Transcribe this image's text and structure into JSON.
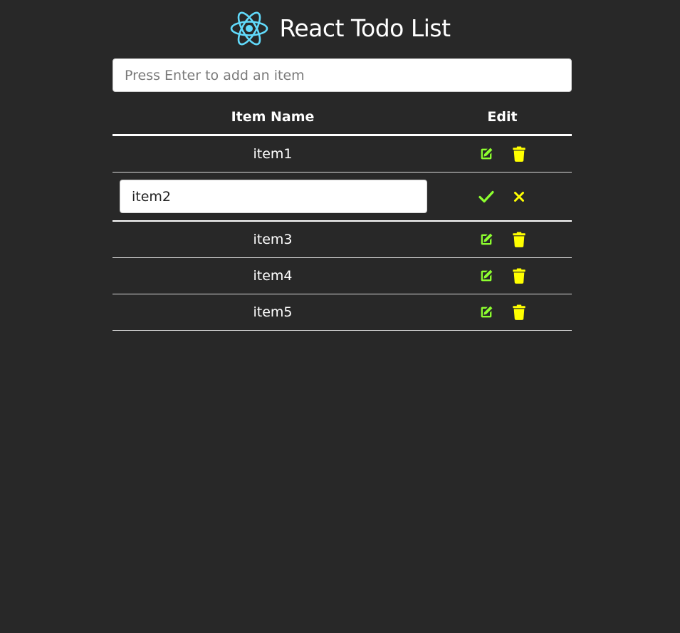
{
  "app": {
    "title": "React Todo List",
    "logo_icon": "react-atom-icon"
  },
  "add_item": {
    "placeholder": "Press Enter to add an item",
    "value": ""
  },
  "table": {
    "headers": {
      "name": "Item Name",
      "edit": "Edit"
    },
    "rows": [
      {
        "label": "item1",
        "editing": false
      },
      {
        "label": "item2",
        "editing": true,
        "edit_value": "item2"
      },
      {
        "label": "item3",
        "editing": false
      },
      {
        "label": "item4",
        "editing": false
      },
      {
        "label": "item5",
        "editing": false
      }
    ]
  },
  "colors": {
    "background": "#282828",
    "edit_icon": "#8dff2f",
    "delete_icon": "#ffff00",
    "confirm_icon": "#8dff2f",
    "cancel_icon": "#ffff00",
    "logo": "#61dafb"
  },
  "icons": {
    "edit": "edit-icon",
    "delete": "trash-icon",
    "confirm": "check-icon",
    "cancel": "close-icon"
  }
}
